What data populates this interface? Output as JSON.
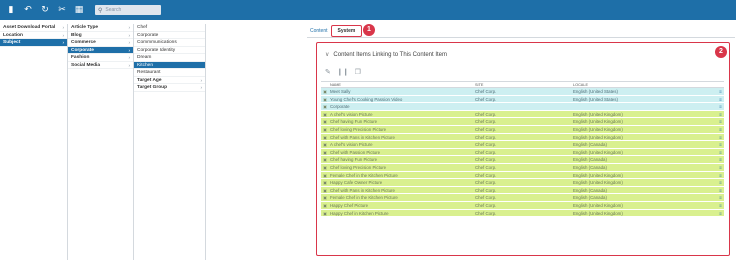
{
  "toolbar": {
    "icons": [
      "trash-icon",
      "undo-icon",
      "refresh-icon",
      "cut-icon",
      "layout-icon"
    ],
    "search_placeholder": "Search"
  },
  "column1": [
    {
      "label": "Asset Download Portal",
      "selected": false,
      "bold": true,
      "chevron": true
    },
    {
      "label": "Location",
      "selected": false,
      "bold": true,
      "chevron": true
    },
    {
      "label": "Subject",
      "selected": true,
      "bold": true,
      "chevron": true
    }
  ],
  "column2": [
    {
      "label": "Article Type",
      "selected": false,
      "bold": true,
      "chevron": true
    },
    {
      "label": "Blog",
      "selected": false,
      "bold": true,
      "chevron": true
    },
    {
      "label": "Commerce",
      "selected": false,
      "bold": true,
      "chevron": true
    },
    {
      "label": "Corporate",
      "selected": true,
      "bold": true,
      "chevron": true
    },
    {
      "label": "Fashion",
      "selected": false,
      "bold": true,
      "chevron": true
    },
    {
      "label": "Social Media",
      "selected": false,
      "bold": true,
      "chevron": true
    }
  ],
  "column3": [
    {
      "label": "Chef",
      "selected": false,
      "bold": false,
      "chevron": false
    },
    {
      "label": "Corporate",
      "selected": false,
      "bold": false,
      "chevron": false
    },
    {
      "label": "Commmunications",
      "selected": false,
      "bold": false,
      "chevron": false
    },
    {
      "label": "Corporate Identity",
      "selected": false,
      "bold": false,
      "chevron": false
    },
    {
      "label": "Dream",
      "selected": false,
      "bold": false,
      "chevron": false
    },
    {
      "label": "Kitchen",
      "selected": true,
      "bold": false,
      "chevron": false
    },
    {
      "label": "Restaurant",
      "selected": false,
      "bold": false,
      "chevron": false
    },
    {
      "label": "Target Age",
      "selected": false,
      "bold": true,
      "chevron": true
    },
    {
      "label": "Target Group",
      "selected": false,
      "bold": true,
      "chevron": true
    }
  ],
  "tabs": [
    {
      "label": "Content",
      "active": false
    },
    {
      "label": "System",
      "active": true
    }
  ],
  "badges": {
    "one": "1",
    "two": "2"
  },
  "panel": {
    "title": "Content Items Linking to This Content Item",
    "actions": [
      "edit-icon",
      "library-icon",
      "copy-icon"
    ]
  },
  "grid": {
    "headers": {
      "name": "NAME",
      "site": "SITE",
      "locale": "LOCALE"
    },
    "rows": [
      {
        "name": "Meet Sally",
        "site": "Chef Corp.",
        "locale": "English (United States)",
        "color": "cyan"
      },
      {
        "name": "Young Chef's Cooking Passion Video",
        "site": "Chef Corp.",
        "locale": "English (United States)",
        "color": "cyan"
      },
      {
        "name": "Corporate",
        "site": "",
        "locale": "",
        "color": "cyan"
      },
      {
        "name": "A chef's vision Picture",
        "site": "Chef Corp.",
        "locale": "English (United Kingdom)",
        "color": "lime"
      },
      {
        "name": "Chef having Fun Picture",
        "site": "Chef Corp.",
        "locale": "English (United Kingdom)",
        "color": "lime"
      },
      {
        "name": "Chef loving Precision Picture",
        "site": "Chef Corp.",
        "locale": "English (United Kingdom)",
        "color": "lime"
      },
      {
        "name": "Chef with Pans in Kitchen Picture",
        "site": "Chef Corp.",
        "locale": "English (United Kingdom)",
        "color": "lime"
      },
      {
        "name": "A chef's vision Picture",
        "site": "Chef Corp.",
        "locale": "English (Canada)",
        "color": "lime"
      },
      {
        "name": "Chef with Passion Picture",
        "site": "Chef Corp.",
        "locale": "English (United Kingdom)",
        "color": "lime"
      },
      {
        "name": "Chef having Fun Picture",
        "site": "Chef Corp.",
        "locale": "English (Canada)",
        "color": "lime"
      },
      {
        "name": "Chef loving Precision Picture",
        "site": "Chef Corp.",
        "locale": "English (Canada)",
        "color": "lime"
      },
      {
        "name": "Female Chef in the Kitchen Picture",
        "site": "Chef Corp.",
        "locale": "English (United Kingdom)",
        "color": "lime"
      },
      {
        "name": "Happy Cafe Owner Picture",
        "site": "Chef Corp.",
        "locale": "English (United Kingdom)",
        "color": "lime"
      },
      {
        "name": "Chef with Pans in Kitchen Picture",
        "site": "Chef Corp.",
        "locale": "English (Canada)",
        "color": "lime"
      },
      {
        "name": "Female Chef in the Kitchen Picture",
        "site": "Chef Corp.",
        "locale": "English (Canada)",
        "color": "lime"
      },
      {
        "name": "Happy Chef Picture",
        "site": "Chef Corp.",
        "locale": "English (United Kingdom)",
        "color": "lime"
      },
      {
        "name": "Happy Chef in Kitchen Picture",
        "site": "Chef Corp.",
        "locale": "English (United Kingdom)",
        "color": "lime"
      }
    ]
  },
  "colors": {
    "accent": "#1e6fa8",
    "highlight": "#d9364a",
    "cyan_row": "#cdeff1",
    "lime_row": "#d9f08f"
  }
}
